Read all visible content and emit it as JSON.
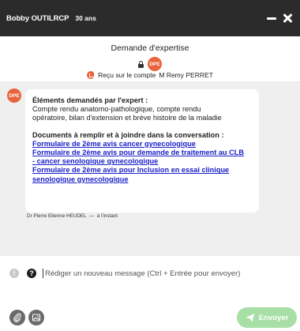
{
  "patient": {
    "name": "Bobby OUTILRCP",
    "age": "30 ans"
  },
  "header": {
    "title": "Demande d'expertise",
    "avatar_initials": "DPE",
    "received_prefix": "Reçu sur le compte",
    "received_account": "M Remy PERRET"
  },
  "message": {
    "avatar_initials": "DPE",
    "requested_heading": "Éléments demandés par l'expert :",
    "requested_text_lines": [
      "Compte rendu anatomo-pathologique, compte rendu",
      "opératoire, bilan d'extension et brève histoire de la maladie"
    ],
    "documents_heading": "Documents à remplir et à joindre dans la conversation :",
    "links": [
      [
        "Formulaire de 2ème avis cancer gynecologique"
      ],
      [
        "Formulaire de 2ème avis pour demande de traitement au CLB",
        "- cancer senologique gynecologique"
      ],
      [
        "Formulaire de 2ème avis pour Inclusion en essai clinique",
        "senologique gynecologique"
      ]
    ],
    "author": "Dr Pierre Etienne HEUDEL",
    "time": "à l'instant"
  },
  "compose": {
    "placeholder": "Rédiger un nouveau message (Ctrl + Entrée pour envoyer)",
    "info_glyph": "!",
    "help_glyph": "?"
  },
  "send_label": "Envoyer",
  "icons": {
    "minimize": "minimize-icon",
    "close": "close-icon",
    "lock": "lock-icon",
    "inbox": "inbox-icon",
    "attach": "paperclip-icon",
    "image": "image-icon",
    "send": "paper-plane-icon"
  },
  "colors": {
    "topbar": "#2b2b2b",
    "avatar": "#e8643c",
    "link": "#1a20c8",
    "send_button": "#a8dfa6",
    "chat_background": "#efefef"
  }
}
